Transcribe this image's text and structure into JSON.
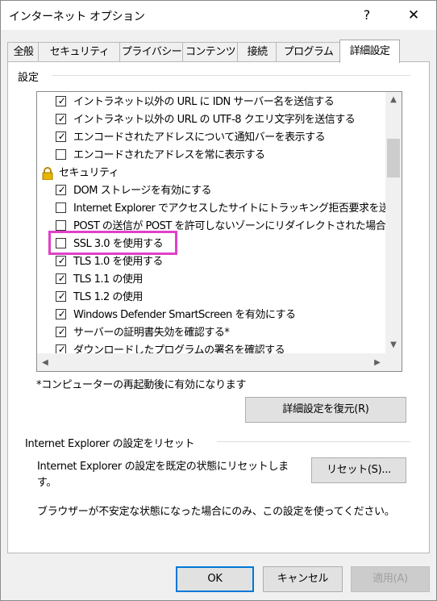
{
  "window": {
    "title": "インターネット オプション",
    "help_glyph": "?",
    "close_glyph": "✕"
  },
  "tabs": [
    {
      "label": "全般"
    },
    {
      "label": "セキュリティ"
    },
    {
      "label": "プライバシー"
    },
    {
      "label": "コンテンツ"
    },
    {
      "label": "接続"
    },
    {
      "label": "プログラム"
    },
    {
      "label": "詳細設定",
      "active": true
    }
  ],
  "settings": {
    "group_label": "設定",
    "items": [
      {
        "type": "checkbox",
        "checked": true,
        "label": "イントラネット以外の URL に IDN サーバー名を送信する"
      },
      {
        "type": "checkbox",
        "checked": true,
        "label": "イントラネット以外の URL の UTF-8 クエリ文字列を送信する"
      },
      {
        "type": "checkbox",
        "checked": true,
        "label": "エンコードされたアドレスについて通知バーを表示する"
      },
      {
        "type": "checkbox",
        "checked": false,
        "label": "エンコードされたアドレスを常に表示する"
      },
      {
        "type": "category",
        "label": "セキュリティ"
      },
      {
        "type": "checkbox",
        "checked": true,
        "label": "DOM ストレージを有効にする"
      },
      {
        "type": "checkbox",
        "checked": false,
        "label": "Internet Explorer でアクセスしたサイトにトラッキング拒否要求を送"
      },
      {
        "type": "checkbox",
        "checked": false,
        "label": "POST の送信が POST を許可しないゾーンにリダイレクトされた場合"
      },
      {
        "type": "checkbox",
        "checked": false,
        "label": "SSL 3.0 を使用する"
      },
      {
        "type": "checkbox",
        "checked": true,
        "label": "TLS 1.0 を使用する"
      },
      {
        "type": "checkbox",
        "checked": true,
        "label": "TLS 1.1 の使用"
      },
      {
        "type": "checkbox",
        "checked": true,
        "label": "TLS 1.2 の使用"
      },
      {
        "type": "checkbox",
        "checked": true,
        "label": "Windows Defender SmartScreen を有効にする"
      },
      {
        "type": "checkbox",
        "checked": true,
        "label": "サーバーの証明書失効を確認する*"
      },
      {
        "type": "checkbox",
        "checked": true,
        "label": "ダウンロードしたプログラムの署名を確認する"
      }
    ],
    "check_glyph": "✓",
    "footnote": "*コンピューターの再起動後に有効になります",
    "restore_button": "詳細設定を復元(R)"
  },
  "reset": {
    "group_label": "Internet Explorer の設定をリセット",
    "description": "Internet Explorer の設定を既定の状態にリセットします。",
    "button": "リセット(S)...",
    "warning": "ブラウザーが不安定な状態になった場合にのみ、この設定を使ってください。"
  },
  "dialog_buttons": {
    "ok": "OK",
    "cancel": "キャンセル",
    "apply": "適用(A)"
  },
  "colors": {
    "highlight": "#e040c8",
    "default_button_border": "#0078d7"
  }
}
